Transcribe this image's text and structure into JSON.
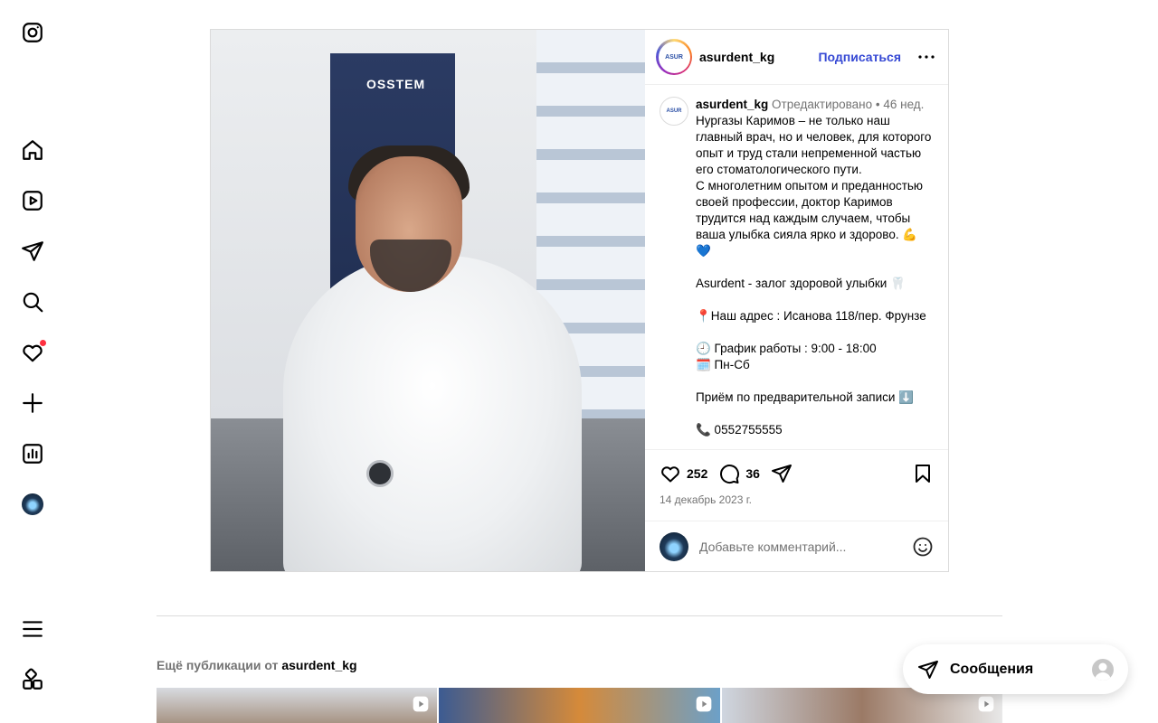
{
  "post": {
    "username": "asurdent_kg",
    "follow_label": "Подписаться",
    "logo_text": "ASUR",
    "image_poster_text": "OSSTEM",
    "caption": {
      "username": "asurdent_kg",
      "meta": "Отредактировано •  46 нед.",
      "lines": [
        "Нургазы Каримов – не только наш главный врач, но и человек, для которого опыт и труд стали непременной частью его стоматологического пути.",
        "С многолетним опытом и преданностью своей профессии, доктор Каримов трудится над каждым случаем, чтобы ваша улыбка сияла ярко и здорово. 💪 💙",
        "",
        "Asurdent - залог здоровой улыбки 🦷",
        "",
        "📍Наш адрес : Исанова 118/пер. Фрунзе",
        "",
        "🕘 График работы : 9:00 - 18:00",
        "🗓️ Пн-Сб",
        "",
        "Приём по предварительной записи ⬇️",
        "",
        "📞 0552755555"
      ]
    },
    "likes": "252",
    "comments": "36",
    "date": "14 декабрь 2023 г.",
    "comment_placeholder": "Добавьте комментарий..."
  },
  "more": {
    "prefix": "Ещё публикации от",
    "username": "asurdent_kg"
  },
  "messages": {
    "label": "Сообщения"
  },
  "nav": {
    "items": [
      "instagram-logo",
      "home",
      "reels",
      "direct",
      "search",
      "notifications",
      "create",
      "dashboard",
      "profile",
      "menu",
      "also-from-meta"
    ]
  },
  "colors": {
    "link": "#3548d4",
    "notification": "#ff3040",
    "muted": "#737373"
  }
}
